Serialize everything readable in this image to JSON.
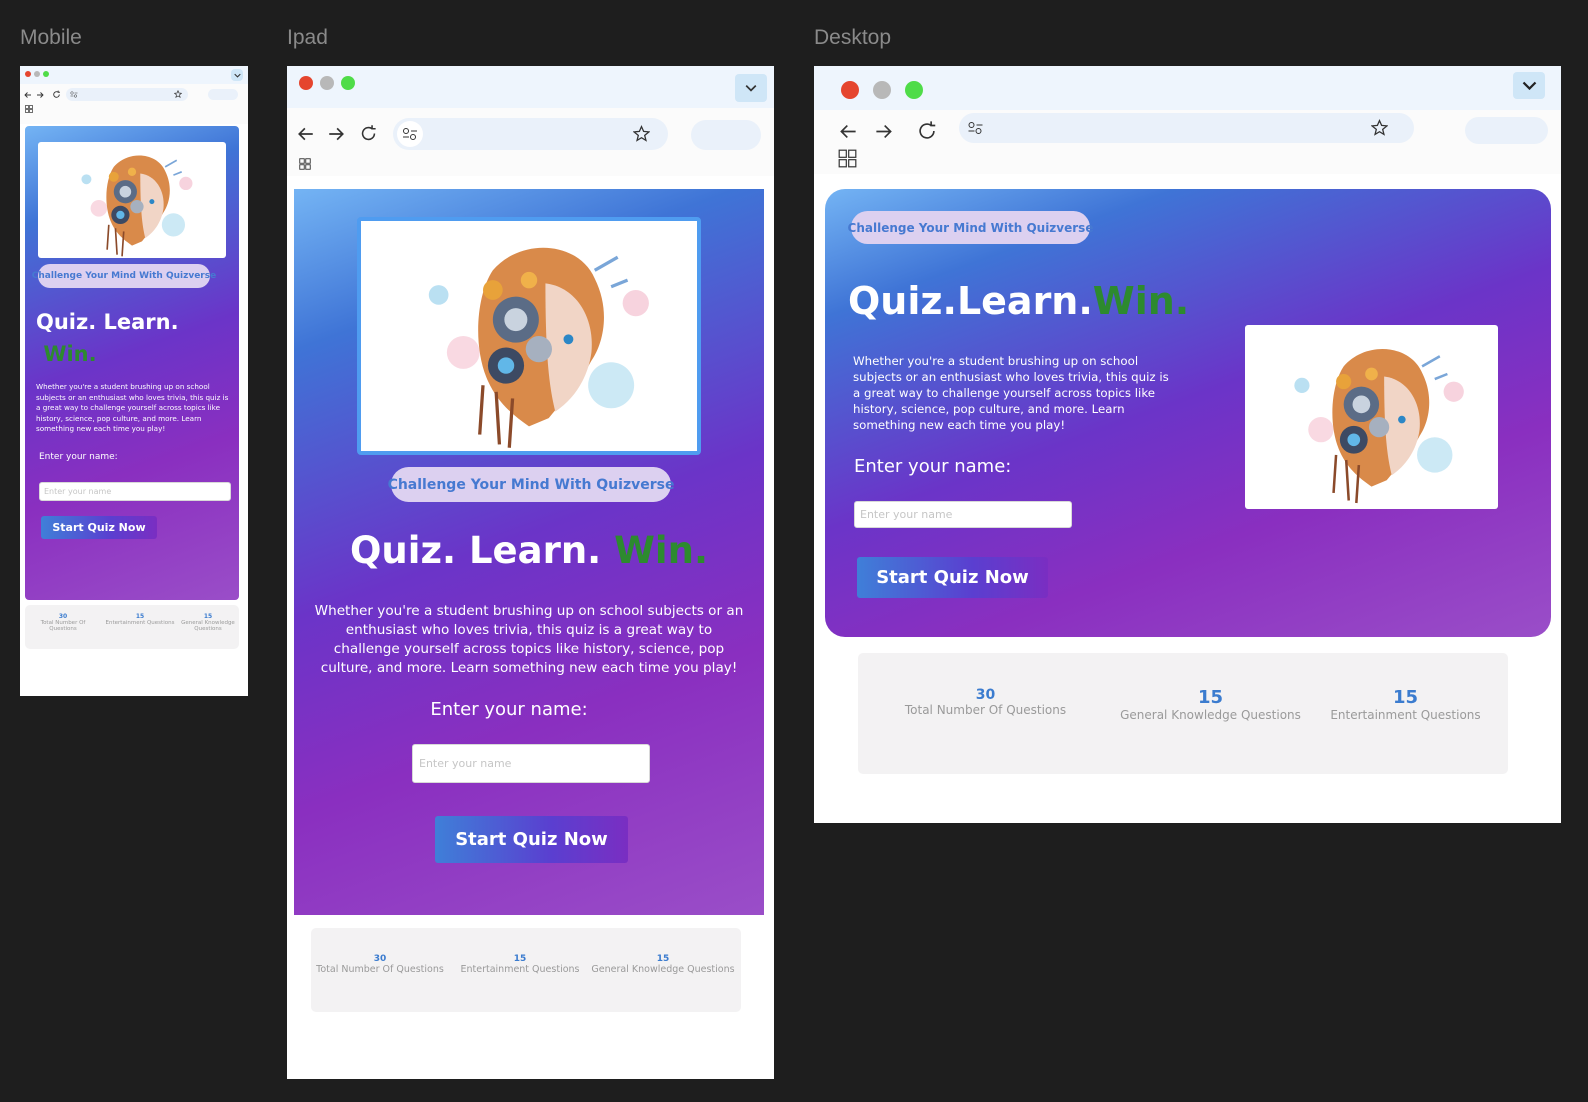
{
  "frames": {
    "mobile_label": "Mobile",
    "ipad_label": "Ipad",
    "desktop_label": "Desktop"
  },
  "hero": {
    "badge": "Challenge Your Mind With Quizverse",
    "headline_part1": "Quiz.",
    "headline_part2": "Learn.",
    "headline_part3": "Win.",
    "paragraph": "Whether you're a student brushing up on school subjects or an enthusiast who loves trivia, this quiz is a great way to challenge yourself across topics like history, science, pop culture, and more. Learn something new each time you play!",
    "name_label": "Enter your name:",
    "name_placeholder": "Enter your name",
    "start_button": "Start Quiz Now",
    "image_alt_icon": "ai-head-illustration-icon"
  },
  "stats": {
    "total": {
      "value": "30",
      "label": "Total Number Of Questions"
    },
    "entertainment": {
      "value": "15",
      "label": "Entertainment Questions"
    },
    "general": {
      "value": "15",
      "label": "General Knowledge Questions"
    }
  },
  "colors": {
    "accent_blue": "#3b7ccf",
    "win_green": "#2d8a2f",
    "hero_purple": "#8a2fc0"
  }
}
